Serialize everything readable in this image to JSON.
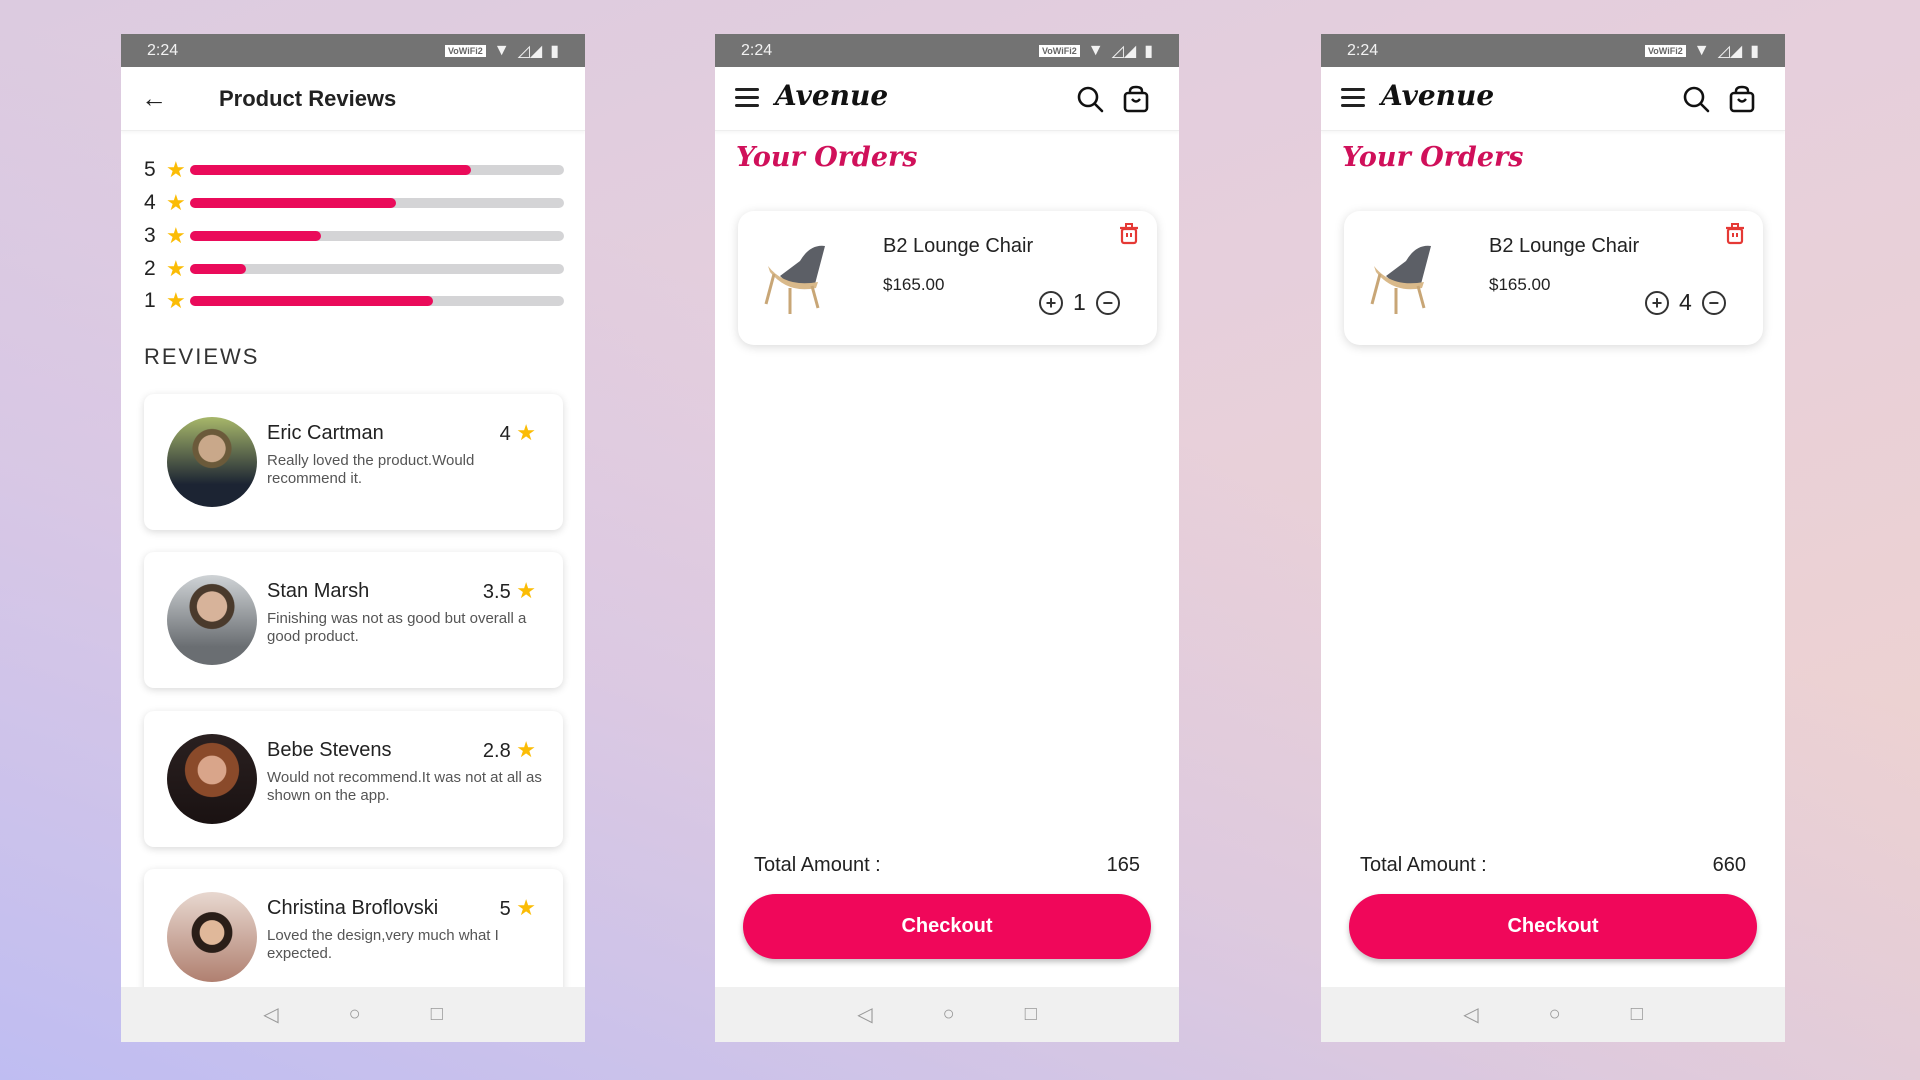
{
  "status": {
    "time": "2:24",
    "wifi_badge": "VoWiFi2"
  },
  "reviews_screen": {
    "title": "Product Reviews",
    "distribution": [
      {
        "stars": "5",
        "percent": 75
      },
      {
        "stars": "4",
        "percent": 55
      },
      {
        "stars": "3",
        "percent": 35
      },
      {
        "stars": "2",
        "percent": 15
      },
      {
        "stars": "1",
        "percent": 65
      }
    ],
    "section_label": "REVIEWS",
    "reviews": [
      {
        "name": "Eric Cartman",
        "rating": "4",
        "text": "Really loved the product.Would recommend it."
      },
      {
        "name": "Stan Marsh",
        "rating": "3.5",
        "text": "Finishing was not as good but overall a good product."
      },
      {
        "name": "Bebe Stevens",
        "rating": "2.8",
        "text": "Would not recommend.It was not at all as shown on the app."
      },
      {
        "name": "Christina Broflovski",
        "rating": "5",
        "text": "Loved the design,very much what I expected."
      }
    ]
  },
  "orders_screens": [
    {
      "logo": "Avenue",
      "title": "Your Orders",
      "item": {
        "name": "B2 Lounge Chair",
        "price": "$165.00",
        "quantity": "1"
      },
      "total_label": "Total Amount :",
      "total_value": "165",
      "checkout_label": "Checkout"
    },
    {
      "logo": "Avenue",
      "title": "Your Orders",
      "item": {
        "name": "B2 Lounge Chair",
        "price": "$165.00",
        "quantity": "4"
      },
      "total_label": "Total Amount :",
      "total_value": "660",
      "checkout_label": "Checkout"
    }
  ],
  "colors": {
    "accent": "#f0075a",
    "star": "#fbbc05",
    "bar_track": "#d4d4d6"
  }
}
